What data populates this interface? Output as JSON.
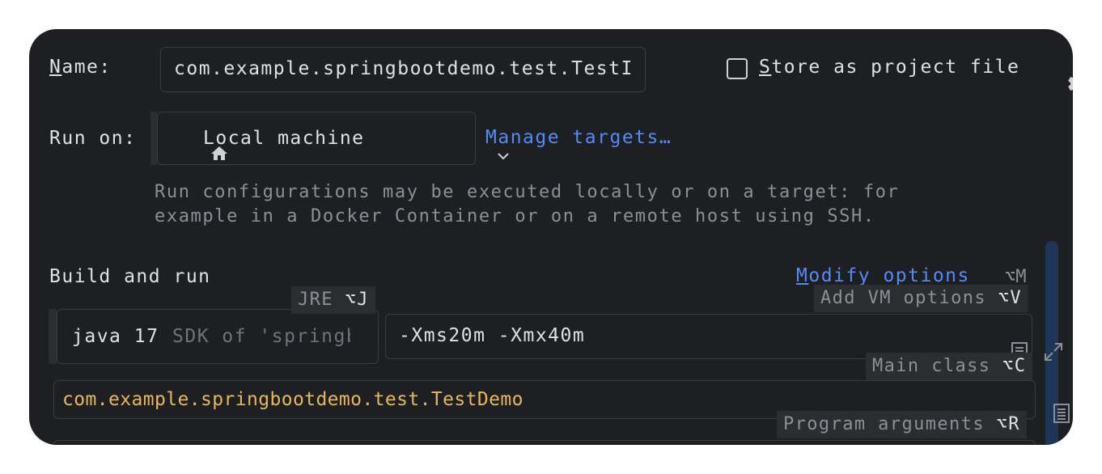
{
  "name": {
    "label": "Name:",
    "value": "com.example.springbootdemo.test.TestI"
  },
  "store_as_project_file": {
    "label": "Store as project file",
    "checked": false
  },
  "run_on": {
    "label": "Run on:",
    "target": "Local machine",
    "manage_link": "Manage targets…",
    "hint_line1": "Run configurations may be executed locally or on a target: for",
    "hint_line2": "example in a Docker Container or on a remote host using SSH."
  },
  "build_and_run": {
    "title": "Build and run",
    "modify_options": "Modify options",
    "modify_shortcut": "⌥M",
    "jre": {
      "name": "java 17",
      "detail": "SDK of 'springbo"
    },
    "vm_options": "-Xms20m -Xmx40m",
    "main_class": "com.example.springbootdemo.test.TestDemo"
  },
  "tooltips": {
    "jre": {
      "label": "JRE",
      "shortcut": "⌥J"
    },
    "vm_options": {
      "label": "Add VM options",
      "shortcut": "⌥V"
    },
    "main_class": {
      "label": "Main class",
      "shortcut": "⌥C"
    },
    "program_arguments": {
      "label": "Program arguments",
      "shortcut": "⌥R"
    }
  },
  "colors": {
    "background": "#1e1f22",
    "link": "#548af7",
    "main_class_text": "#e8b65f",
    "hint_text": "#8c8f94"
  }
}
